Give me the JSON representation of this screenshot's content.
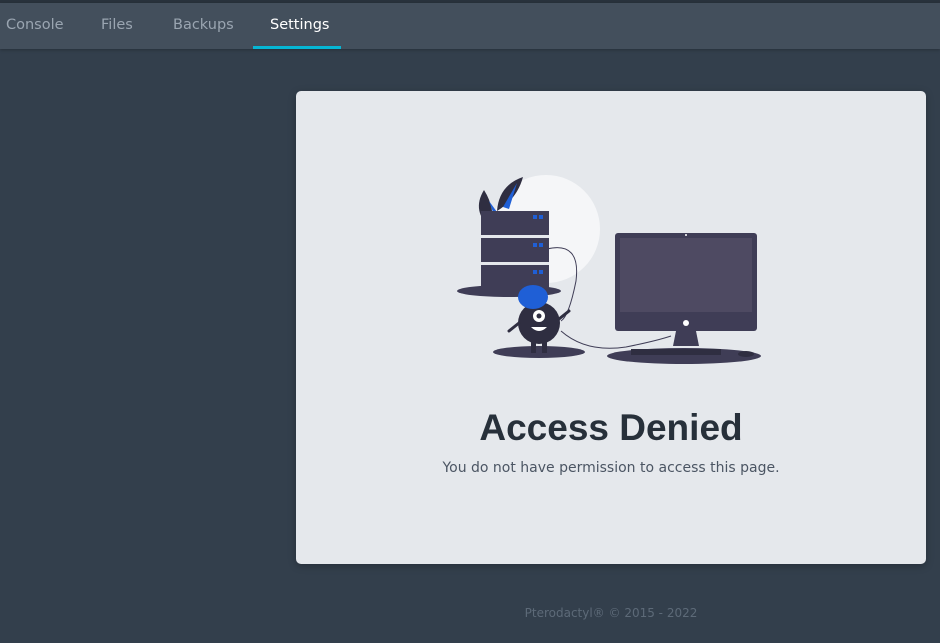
{
  "nav": {
    "tabs": [
      {
        "label": "Console"
      },
      {
        "label": "Files"
      },
      {
        "label": "Backups"
      },
      {
        "label": "Settings",
        "active": true
      }
    ]
  },
  "card": {
    "title": "Access Denied",
    "message": "You do not have permission to access this page."
  },
  "footer": {
    "text": "Pterodactyl® © 2015 - 2022"
  },
  "colors": {
    "background": "#333f4c",
    "nav": "#434f5c",
    "accent": "#06b6d4",
    "card": "#e5e8ec",
    "illustration_dark": "#3f3d56",
    "illustration_blue": "#1f5fd6"
  }
}
